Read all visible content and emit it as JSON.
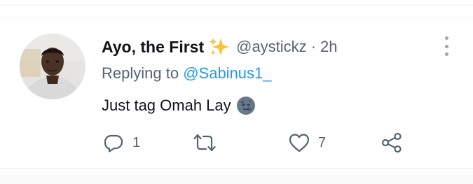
{
  "tweet": {
    "display_name": "Ayo, the First",
    "name_emoji": "sparkles-icon",
    "handle": "@aystickz",
    "separator": "·",
    "time": "2h",
    "replying_prefix": "Replying to",
    "replying_to": "@Sabinus1_",
    "text": "Just tag Omah Lay",
    "text_emoji": "moon-face-icon",
    "actions": {
      "reply_count": "1",
      "like_count": "7"
    }
  },
  "colors": {
    "accent": "#1d9bf0",
    "secondary_text": "#536471",
    "primary_text": "#0f1419"
  }
}
